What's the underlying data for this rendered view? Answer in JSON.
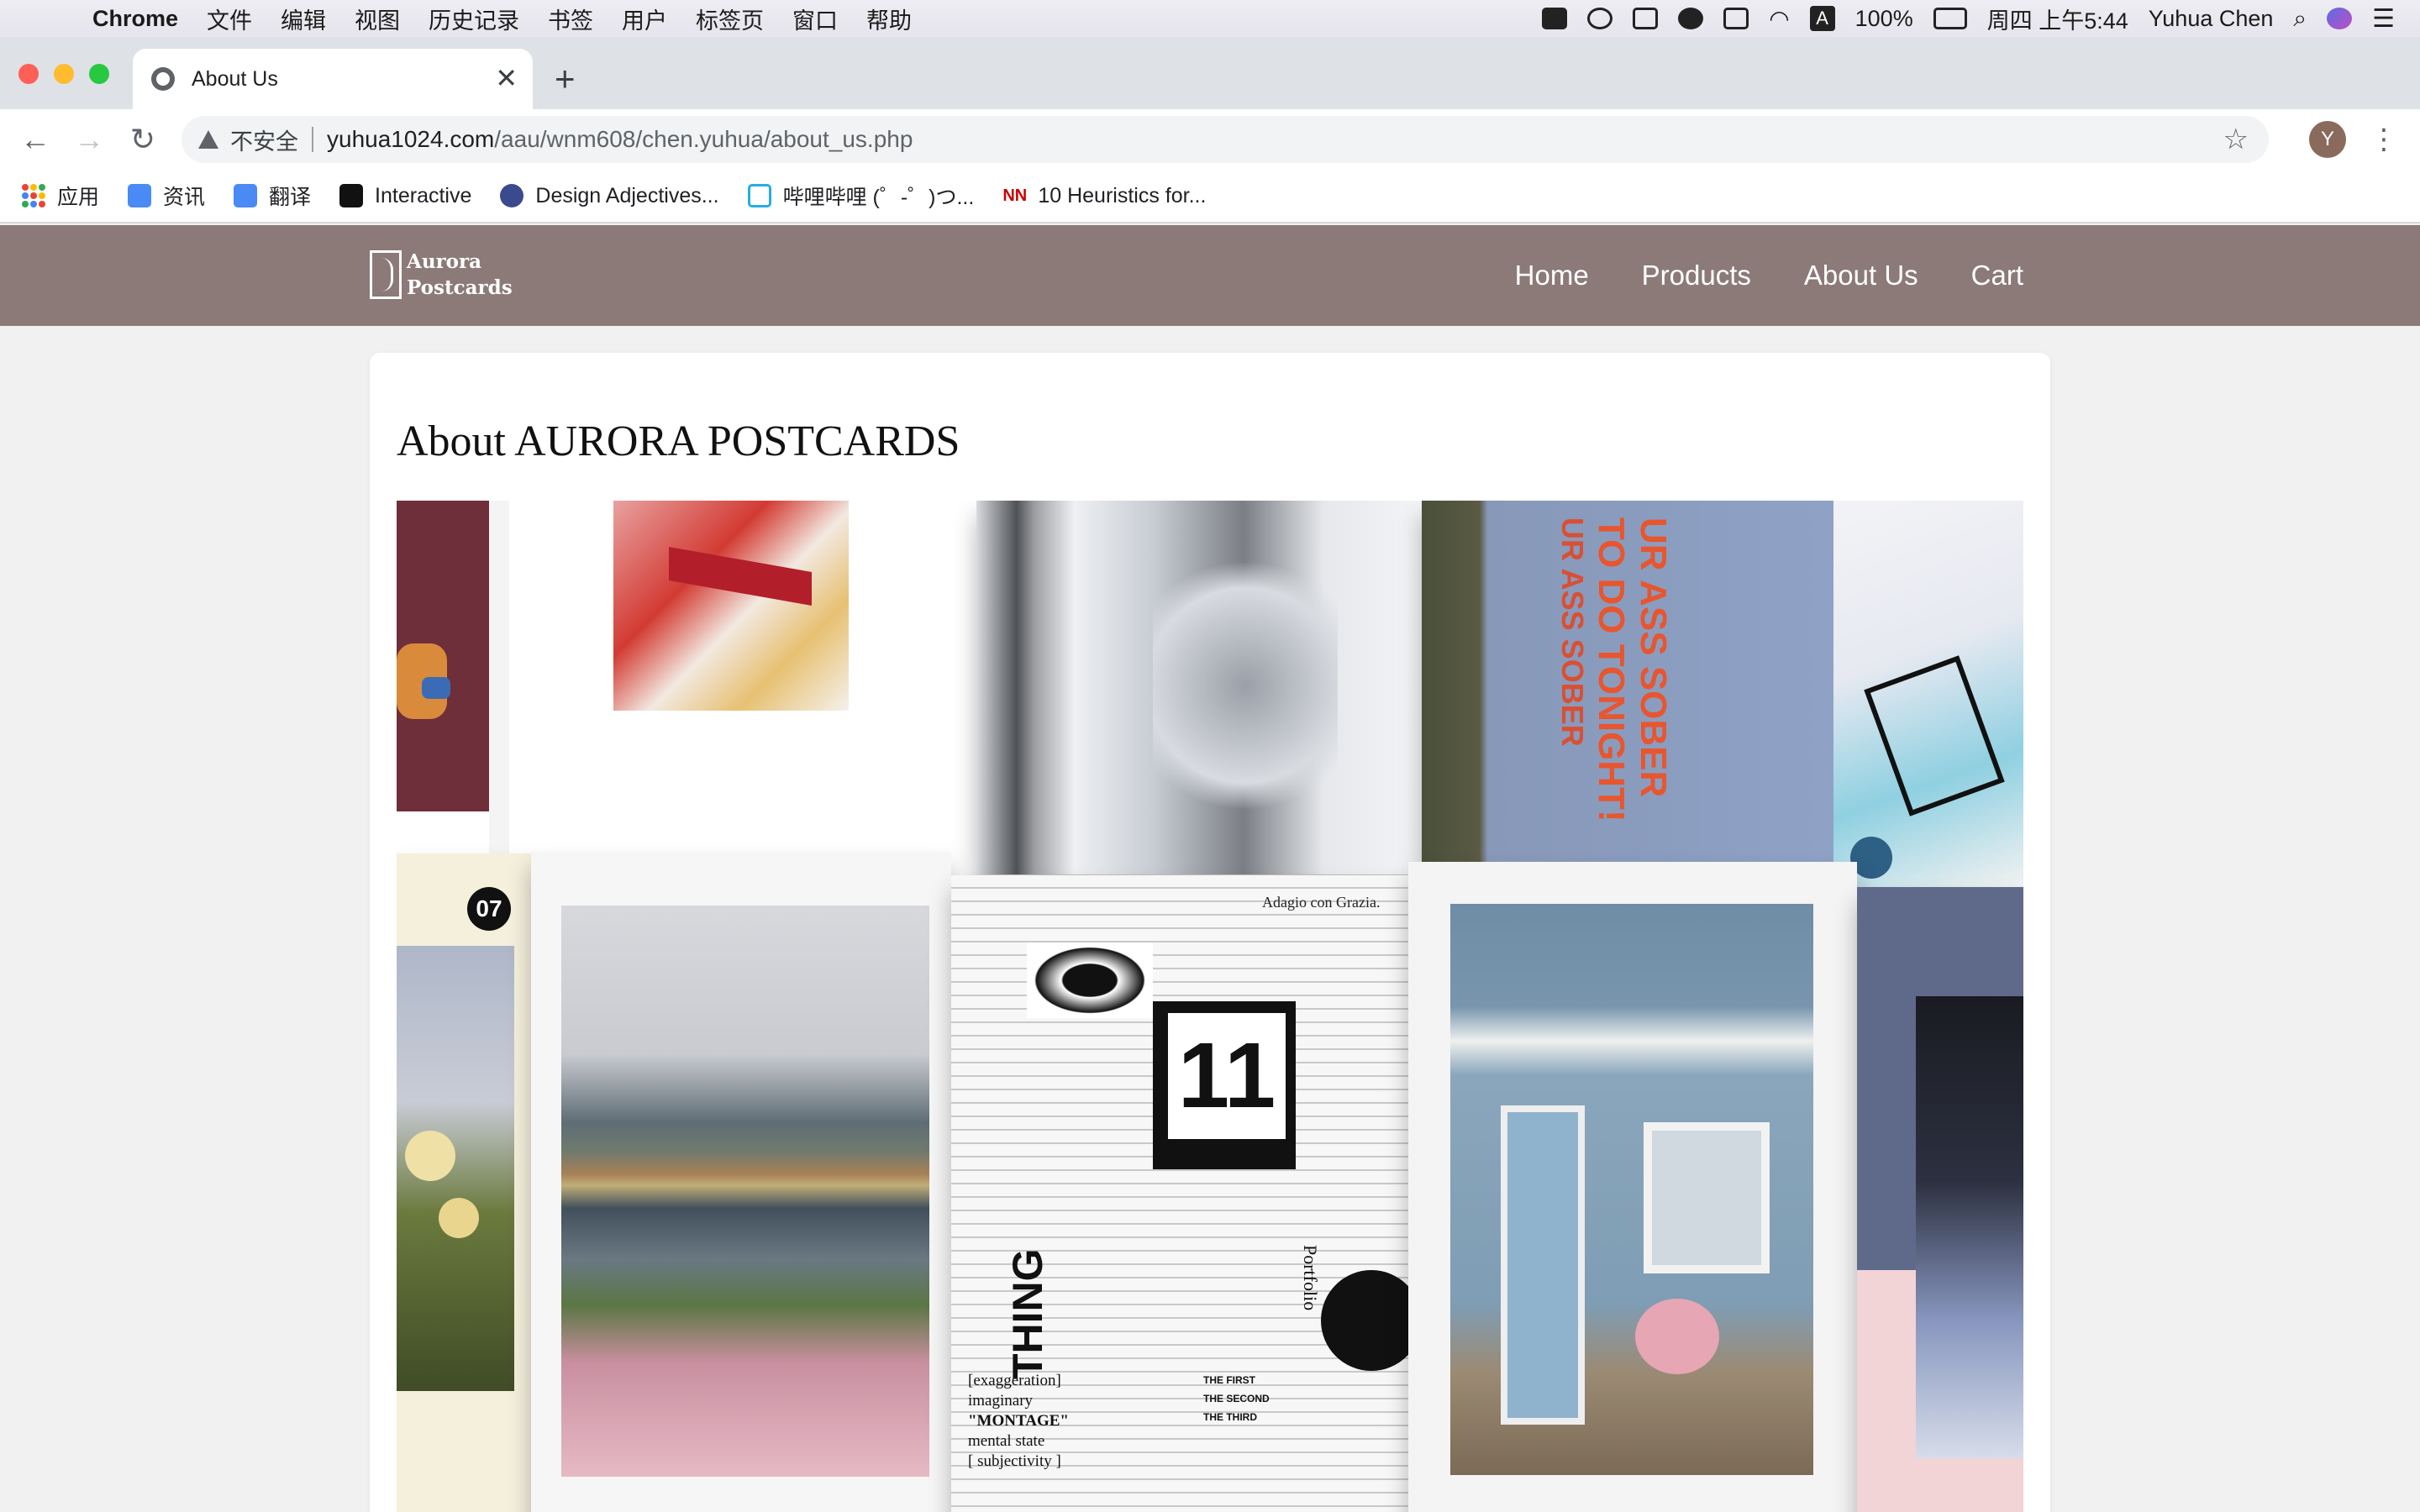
{
  "menubar": {
    "app": "Chrome",
    "items": [
      "文件",
      "编辑",
      "视图",
      "历史记录",
      "书签",
      "用户",
      "标签页",
      "窗口",
      "帮助"
    ],
    "battery": "100%",
    "clock": "周四 上午5:44",
    "user": "Yuhua Chen"
  },
  "tab": {
    "title": "About Us"
  },
  "toolbar": {
    "insecure_label": "不安全",
    "url_domain": "yuhua1024.com",
    "url_path": "/aau/wnm608/chen.yuhua/about_us.php",
    "avatar_letter": "Y"
  },
  "bookmarks": [
    {
      "label": "应用",
      "icon": "apps-grid-icon"
    },
    {
      "label": "资讯",
      "icon": "news-icon"
    },
    {
      "label": "翻译",
      "icon": "translate-icon"
    },
    {
      "label": "Interactive",
      "icon": "interactive-icon"
    },
    {
      "label": "Design Adjectives...",
      "icon": "butterfly-icon"
    },
    {
      "label": "哔哩哔哩 (゜-゜)つ...",
      "icon": "bilibili-icon"
    },
    {
      "label": "10 Heuristics for...",
      "icon": "nn-icon"
    }
  ],
  "site": {
    "logo_line1": "Aurora",
    "logo_line2": "Postcards",
    "nav": [
      "Home",
      "Products",
      "About Us",
      "Cart"
    ],
    "heading": "About AURORA POSTCARDS",
    "header_color": "#8c7a78"
  },
  "collage": {
    "poster_text_1": "UR ASS SOBER",
    "poster_text_2": "TO DO TONIGHT!",
    "badge": "07",
    "calendar_number": "11",
    "music_title": "Adagio con Grazia.",
    "thing_text": "THING",
    "portfolio": "Portfolio",
    "montage_lines": [
      "[exaggeration]",
      "imaginary",
      "\"MONTAGE\"",
      "mental state",
      "[ subjectivity ]"
    ],
    "first_lines": [
      "THE FIRST",
      "THE SECOND",
      "THE THIRD"
    ]
  }
}
